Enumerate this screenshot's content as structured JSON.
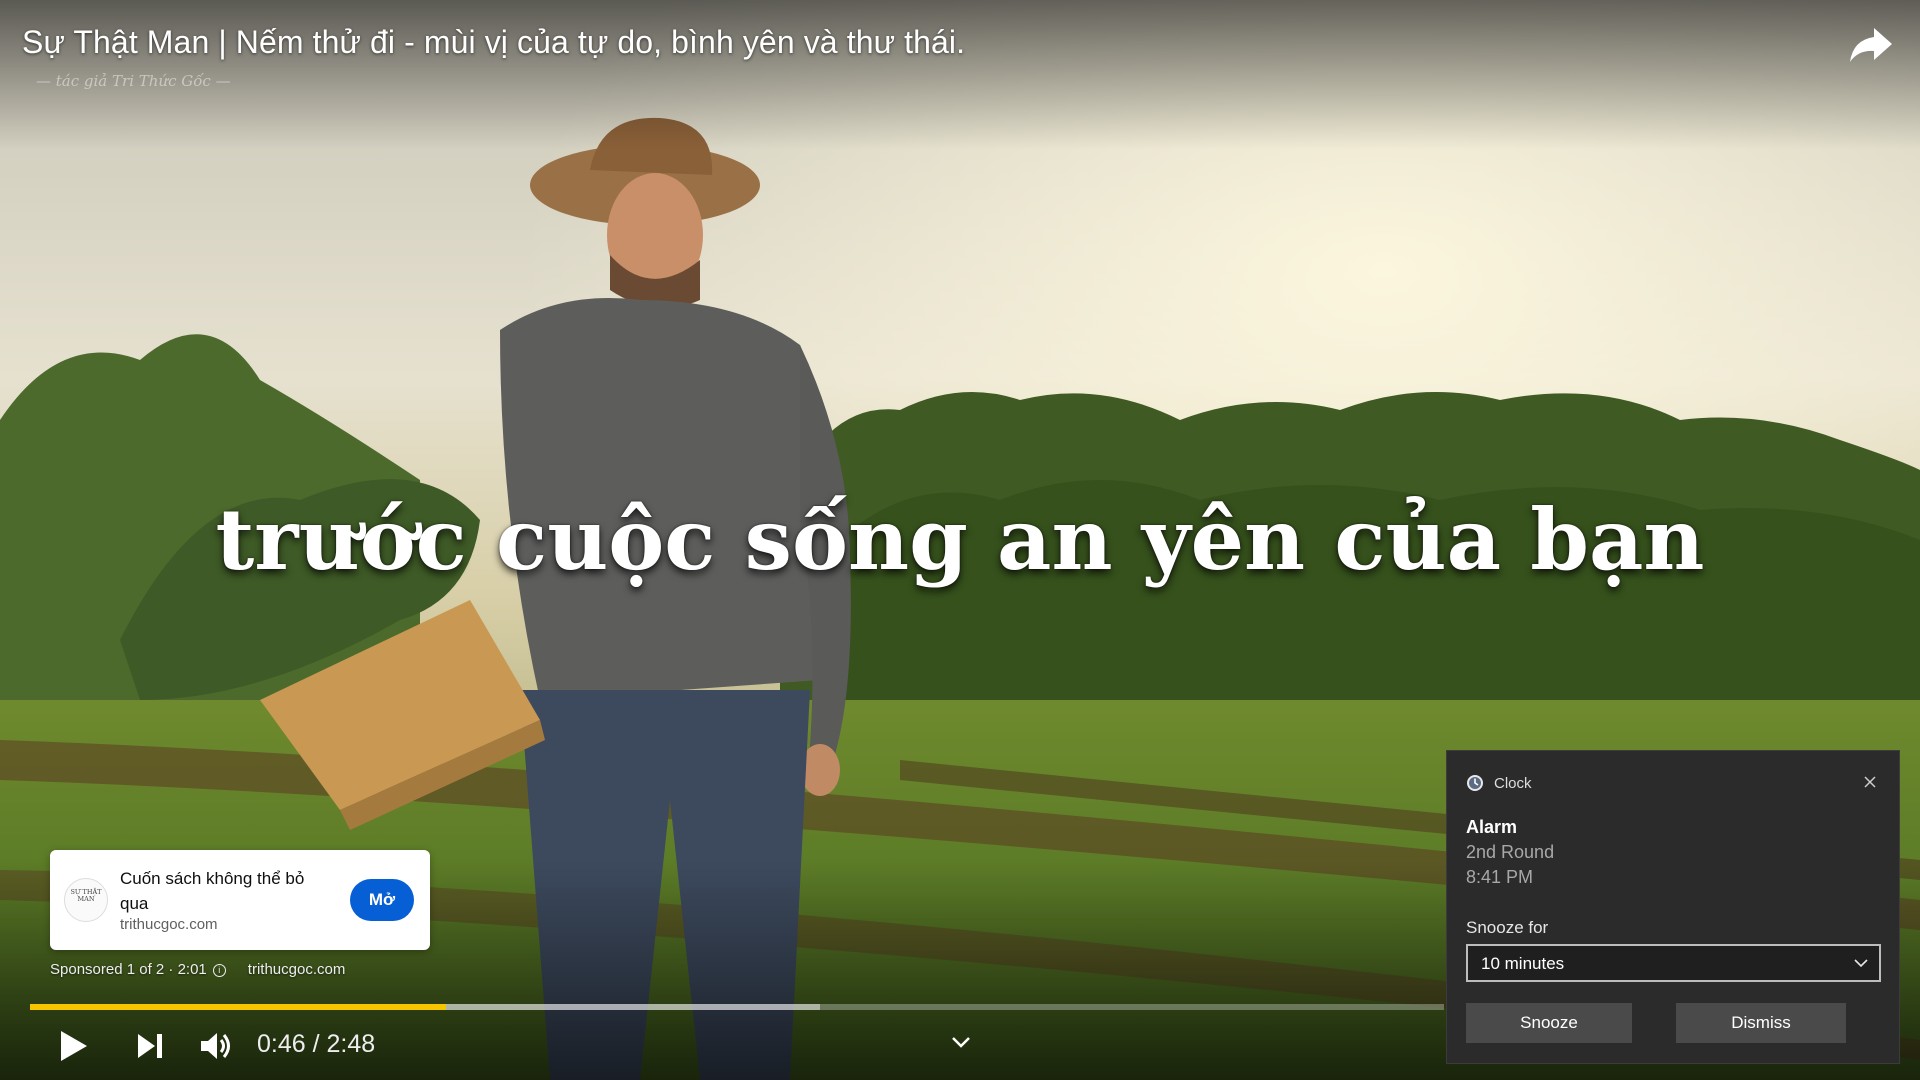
{
  "video": {
    "title": "Sự Thật Man | Nếm thử đi - mùi vị của tự do, bình yên và thư thái.",
    "watermark": "— tác giả Tri Thức Gốc —",
    "subtitle": "trước cuộc sống an yên của bạn",
    "share_icon": "share-arrow-icon"
  },
  "ad": {
    "logo_text": "SỰ THẬT MAN",
    "title": "Cuốn sách không thể bỏ qua",
    "domain": "trithucgoc.com",
    "open_label": "Mở",
    "sponsored": "Sponsored 1 of 2 · 2:01",
    "info_glyph": "i",
    "meta_domain": "trithucgoc.com"
  },
  "player": {
    "current_time": "0:46",
    "duration": "2:48",
    "time_display": "0:46 / 2:48",
    "played_fraction": 0.294,
    "buffered_fraction": 0.559,
    "progress_color": "#f7c500",
    "icons": [
      "play-icon",
      "next-icon",
      "volume-icon",
      "chevron-down-icon"
    ]
  },
  "toast": {
    "app_name": "Clock",
    "heading": "Alarm",
    "line2": "2nd Round",
    "line3": "8:41 PM",
    "snooze_label": "Snooze for",
    "snooze_value": "10 minutes",
    "snooze_button": "Snooze",
    "dismiss_button": "Dismiss",
    "background": "#2b2b2b",
    "icons": [
      "clock-app-icon",
      "close-icon",
      "dropdown-chevron-icon"
    ]
  }
}
